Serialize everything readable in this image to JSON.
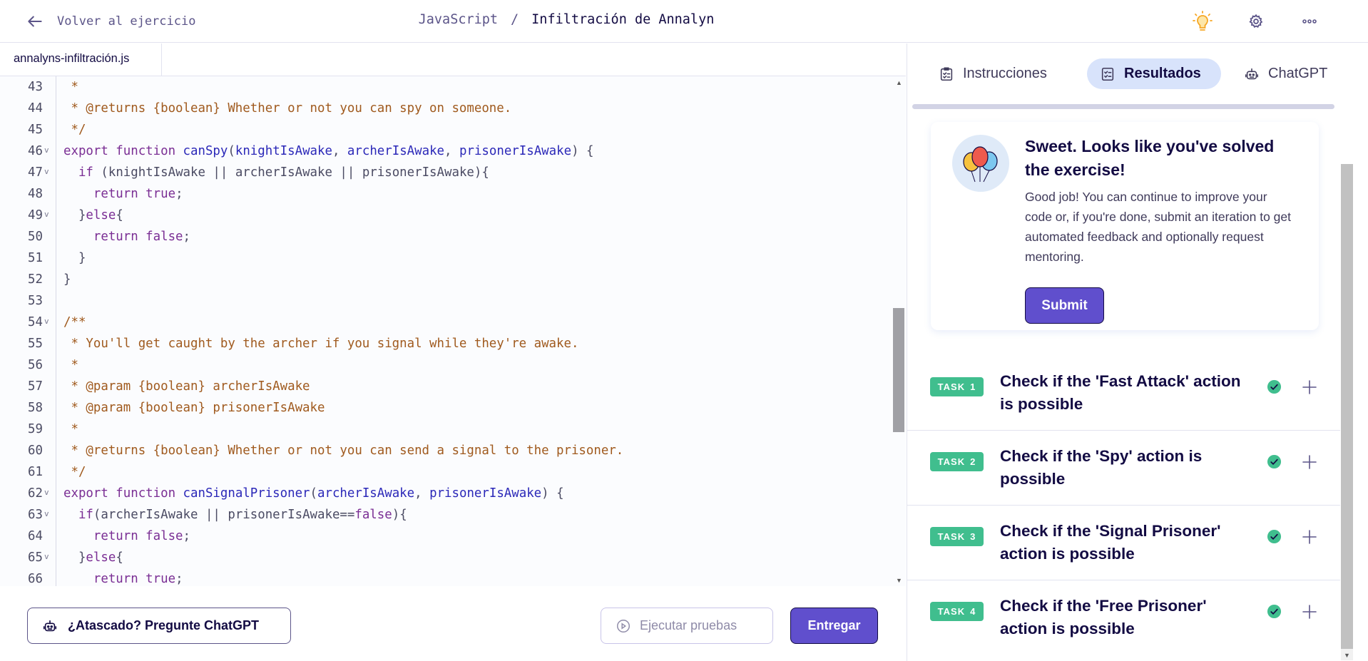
{
  "topbar": {
    "back_label": "Volver al ejercicio",
    "track": "JavaScript",
    "separator": "/",
    "exercise": "Infiltración de Annalyn"
  },
  "icons": {
    "back": "arrow-left-icon",
    "hint": "lightbulb-icon",
    "settings": "gear-icon",
    "more": "more-horizontal-icon",
    "chatgpt": "robot-icon",
    "run": "play-circle-icon",
    "instructions": "checklist-icon",
    "results": "results-checklist-icon",
    "check": "check-circle-icon",
    "expand": "plus-icon",
    "celebration": "balloons-icon"
  },
  "colors": {
    "accent": "#604fcd",
    "task_badge": "#40be8e",
    "hint_icon": "#f6a623",
    "text_dark": "#130b43",
    "active_tab_bg": "#d8e3fb"
  },
  "editor": {
    "filename": "annalyns-infiltración.js",
    "lines": [
      {
        "n": "43",
        "fold": false,
        "tokens": [
          {
            "t": " *",
            "c": "cm"
          }
        ]
      },
      {
        "n": "44",
        "fold": false,
        "tokens": [
          {
            "t": " * @returns {boolean} Whether or not you can spy on someone.",
            "c": "cm"
          }
        ]
      },
      {
        "n": "45",
        "fold": false,
        "tokens": [
          {
            "t": " */",
            "c": "cm"
          }
        ]
      },
      {
        "n": "46",
        "fold": true,
        "tokens": [
          {
            "t": "export function ",
            "c": "kw"
          },
          {
            "t": "canSpy",
            "c": "fn"
          },
          {
            "t": "(",
            "c": "pl"
          },
          {
            "t": "knightIsAwake",
            "c": "pr"
          },
          {
            "t": ", ",
            "c": "pl"
          },
          {
            "t": "archerIsAwake",
            "c": "pr"
          },
          {
            "t": ", ",
            "c": "pl"
          },
          {
            "t": "prisonerIsAwake",
            "c": "pr"
          },
          {
            "t": ") {",
            "c": "pl"
          }
        ]
      },
      {
        "n": "47",
        "fold": true,
        "tokens": [
          {
            "t": "  ",
            "c": "pl"
          },
          {
            "t": "if",
            "c": "kw"
          },
          {
            "t": " (knightIsAwake || archerIsAwake || prisonerIsAwake){",
            "c": "pl"
          }
        ]
      },
      {
        "n": "48",
        "fold": false,
        "tokens": [
          {
            "t": "    ",
            "c": "pl"
          },
          {
            "t": "return true",
            "c": "kw"
          },
          {
            "t": ";",
            "c": "pl"
          }
        ]
      },
      {
        "n": "49",
        "fold": true,
        "tokens": [
          {
            "t": "  }",
            "c": "pl"
          },
          {
            "t": "else",
            "c": "kw"
          },
          {
            "t": "{",
            "c": "pl"
          }
        ]
      },
      {
        "n": "50",
        "fold": false,
        "tokens": [
          {
            "t": "    ",
            "c": "pl"
          },
          {
            "t": "return false",
            "c": "kw"
          },
          {
            "t": ";",
            "c": "pl"
          }
        ]
      },
      {
        "n": "51",
        "fold": false,
        "tokens": [
          {
            "t": "  }",
            "c": "pl"
          }
        ]
      },
      {
        "n": "52",
        "fold": false,
        "tokens": [
          {
            "t": "}",
            "c": "pl"
          }
        ]
      },
      {
        "n": "53",
        "fold": false,
        "tokens": []
      },
      {
        "n": "54",
        "fold": true,
        "tokens": [
          {
            "t": "/**",
            "c": "cm"
          }
        ]
      },
      {
        "n": "55",
        "fold": false,
        "tokens": [
          {
            "t": " * You'll get caught by the archer if you signal while they're awake.",
            "c": "cm"
          }
        ]
      },
      {
        "n": "56",
        "fold": false,
        "tokens": [
          {
            "t": " *",
            "c": "cm"
          }
        ]
      },
      {
        "n": "57",
        "fold": false,
        "tokens": [
          {
            "t": " * @param {boolean} archerIsAwake",
            "c": "cm"
          }
        ]
      },
      {
        "n": "58",
        "fold": false,
        "tokens": [
          {
            "t": " * @param {boolean} prisonerIsAwake",
            "c": "cm"
          }
        ]
      },
      {
        "n": "59",
        "fold": false,
        "tokens": [
          {
            "t": " *",
            "c": "cm"
          }
        ]
      },
      {
        "n": "60",
        "fold": false,
        "tokens": [
          {
            "t": " * @returns {boolean} Whether or not you can send a signal to the prisoner.",
            "c": "cm"
          }
        ]
      },
      {
        "n": "61",
        "fold": false,
        "tokens": [
          {
            "t": " */",
            "c": "cm"
          }
        ]
      },
      {
        "n": "62",
        "fold": true,
        "tokens": [
          {
            "t": "export function ",
            "c": "kw"
          },
          {
            "t": "canSignalPrisoner",
            "c": "fn"
          },
          {
            "t": "(",
            "c": "pl"
          },
          {
            "t": "archerIsAwake",
            "c": "pr"
          },
          {
            "t": ", ",
            "c": "pl"
          },
          {
            "t": "prisonerIsAwake",
            "c": "pr"
          },
          {
            "t": ") {",
            "c": "pl"
          }
        ]
      },
      {
        "n": "63",
        "fold": true,
        "tokens": [
          {
            "t": "  ",
            "c": "pl"
          },
          {
            "t": "if",
            "c": "kw"
          },
          {
            "t": "(archerIsAwake || prisonerIsAwake==",
            "c": "pl"
          },
          {
            "t": "false",
            "c": "kw"
          },
          {
            "t": "){",
            "c": "pl"
          }
        ]
      },
      {
        "n": "64",
        "fold": false,
        "tokens": [
          {
            "t": "    ",
            "c": "pl"
          },
          {
            "t": "return false",
            "c": "kw"
          },
          {
            "t": ";",
            "c": "pl"
          }
        ]
      },
      {
        "n": "65",
        "fold": true,
        "tokens": [
          {
            "t": "  }",
            "c": "pl"
          },
          {
            "t": "else",
            "c": "kw"
          },
          {
            "t": "{",
            "c": "pl"
          }
        ]
      },
      {
        "n": "66",
        "fold": false,
        "tokens": [
          {
            "t": "    ",
            "c": "pl"
          },
          {
            "t": "return true",
            "c": "kw"
          },
          {
            "t": ";",
            "c": "pl"
          }
        ]
      }
    ]
  },
  "actions": {
    "chatgpt_label": "¿Atascado? Pregunte ChatGPT",
    "run_tests_label": "Ejecutar pruebas",
    "submit_label": "Entregar"
  },
  "tabs": [
    {
      "label": "Instrucciones",
      "active": false
    },
    {
      "label": "Resultados",
      "active": true
    },
    {
      "label": "ChatGPT",
      "active": false
    }
  ],
  "success": {
    "title": "Sweet. Looks like you've solved the exercise!",
    "text": "Good job! You can continue to improve your code or, if you're done, submit an iteration to get automated feedback and optionally request mentoring.",
    "submit_label": "Submit"
  },
  "tasks": [
    {
      "badge_word": "TASK",
      "number": "1",
      "title": "Check if the 'Fast Attack' action is possible",
      "passed": true
    },
    {
      "badge_word": "TASK",
      "number": "2",
      "title": "Check if the 'Spy' action is possible",
      "passed": true
    },
    {
      "badge_word": "TASK",
      "number": "3",
      "title": "Check if the 'Signal Prisoner' action is possible",
      "passed": true
    },
    {
      "badge_word": "TASK",
      "number": "4",
      "title": "Check if the 'Free Prisoner' action is possible",
      "passed": true
    }
  ]
}
